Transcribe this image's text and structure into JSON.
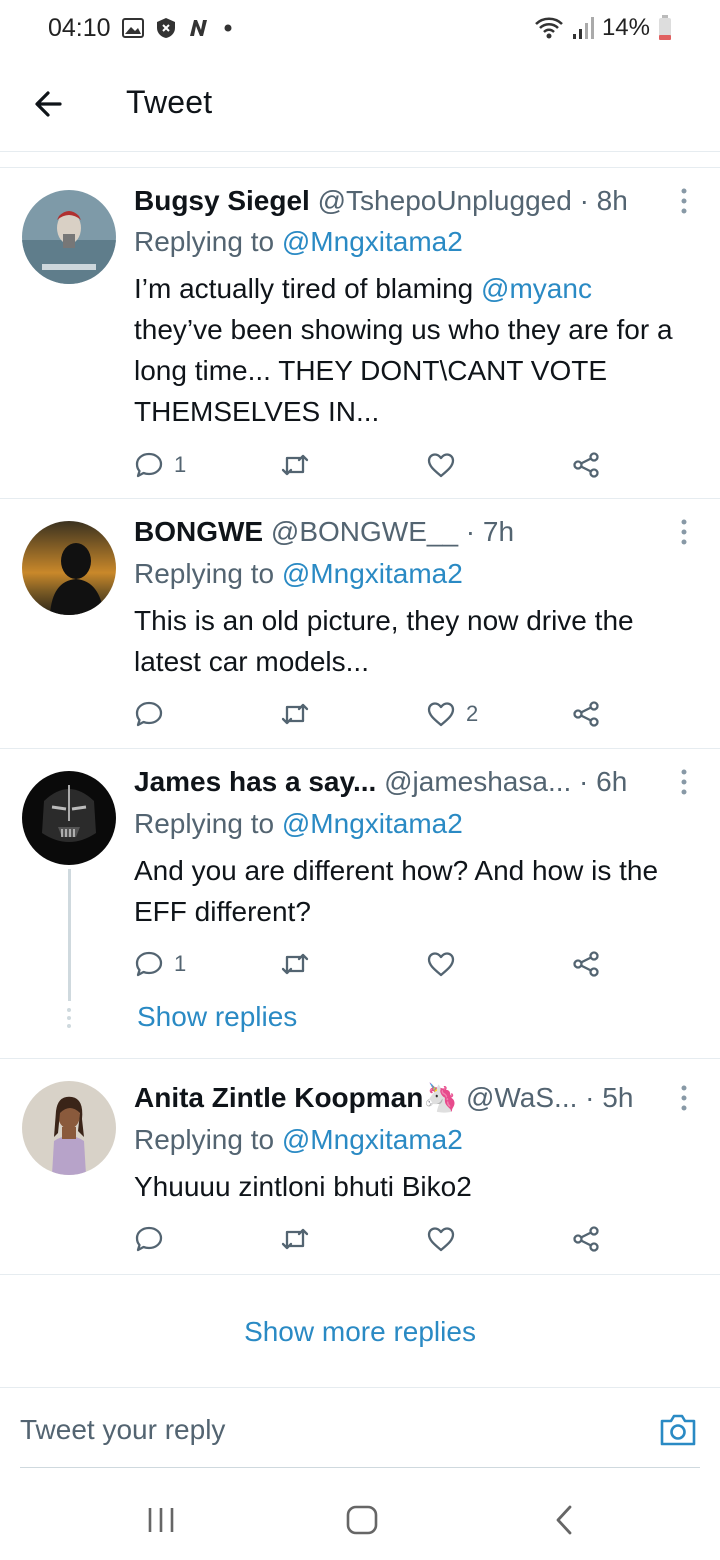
{
  "status_bar": {
    "time": "04:10",
    "battery": "14%"
  },
  "header": {
    "title": "Tweet"
  },
  "tweets": [
    {
      "name": "Bugsy Siegel",
      "meta": "@TshepoUnplugged · 8h",
      "replying_label": "Replying to",
      "replying_handle": "@Mngxitama2",
      "text_before": "I’m actually tired of blaming ",
      "text_mention": "@myanc",
      "text_after": " they’ve been showing us who they are for a long time... THEY DONT\\CANT VOTE THEMSELVES IN...",
      "reply_count": "1",
      "retweet_count": "",
      "like_count": ""
    },
    {
      "name": "BONGWE",
      "meta": "@BONGWE__ · 7h",
      "replying_label": "Replying to",
      "replying_handle": "@Mngxitama2",
      "text": "This is an old picture, they now drive the latest car models...",
      "reply_count": "",
      "retweet_count": "",
      "like_count": "2"
    },
    {
      "name": "James has a say...",
      "meta": "@jameshasa... · 6h",
      "replying_label": "Replying to",
      "replying_handle": "@Mngxitama2",
      "text": "And you are different how? And how is the EFF different?",
      "reply_count": "1",
      "retweet_count": "",
      "like_count": "",
      "show_replies": "Show replies"
    },
    {
      "name": "Anita Zintle Koopman",
      "name_emoji": "🦄",
      "meta": "@WaS... · 5h",
      "replying_label": "Replying to",
      "replying_handle": "@Mngxitama2",
      "text": "Yhuuuu zintloni bhuti Biko2",
      "reply_count": "",
      "retweet_count": "",
      "like_count": ""
    }
  ],
  "show_more": "Show more replies",
  "reply_box": {
    "placeholder": "Tweet your reply"
  },
  "colors": {
    "link": "#2a8ac4",
    "text": "#0f1419",
    "muted": "#536471",
    "divider": "#e6ecf0"
  }
}
